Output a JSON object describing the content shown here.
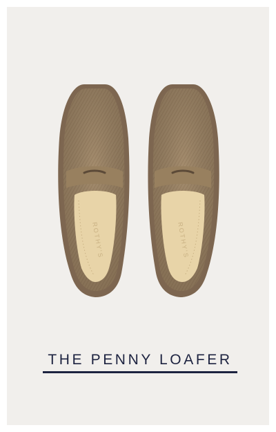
{
  "product": {
    "name": "THE PENNY LOAFER",
    "image_alt": "Pair of tan knit penny loafers, top-down view",
    "insole_brand": "ROTHY'S"
  },
  "colors": {
    "background": "#f1efec",
    "shoe_upper": "#a58d6e",
    "shoe_sole": "#7d6650",
    "insole": "#e8d4a8",
    "text": "#1d2340"
  }
}
